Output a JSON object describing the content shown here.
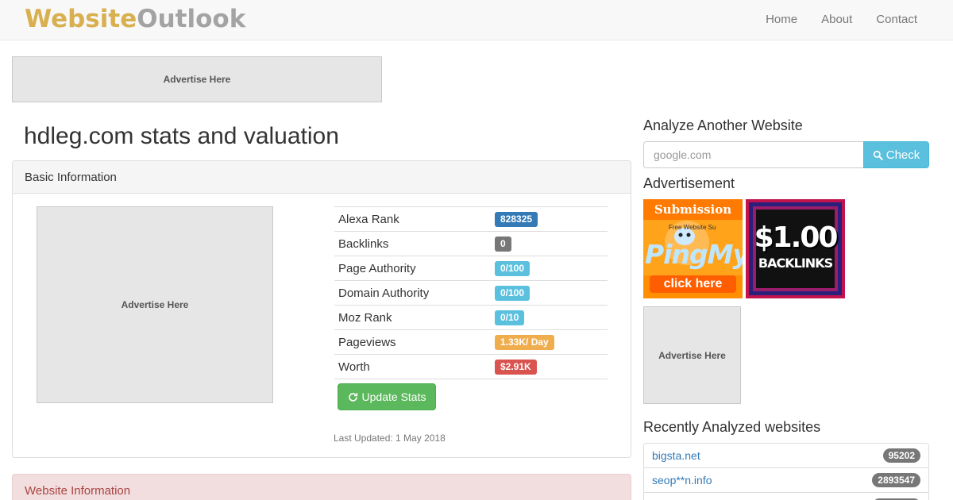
{
  "brand": {
    "part1": "Website",
    "part2": "Outlook"
  },
  "nav": {
    "home": "Home",
    "about": "About",
    "contact": "Contact"
  },
  "ads": {
    "top": "Advertise Here",
    "panel": "Advertise Here",
    "side": "Advertise Here"
  },
  "page_title": "hdleg.com stats and valuation",
  "basic_info": {
    "heading": "Basic Information",
    "rows": [
      {
        "label": "Alexa Rank",
        "value": "828325",
        "color": "#337ab7"
      },
      {
        "label": "Backlinks",
        "value": "0",
        "color": "#777777"
      },
      {
        "label": "Page Authority",
        "value": "0/100",
        "color": "#5bc0de"
      },
      {
        "label": "Domain Authority",
        "value": "0/100",
        "color": "#5bc0de"
      },
      {
        "label": "Moz Rank",
        "value": "0/10",
        "color": "#5bc0de"
      },
      {
        "label": "Pageviews",
        "value": "1.33K/ Day",
        "color": "#f0ad4e"
      },
      {
        "label": "Worth",
        "value": "$2.91K",
        "color": "#d9534f"
      }
    ],
    "update_button": "Update Stats",
    "last_updated": "Last Updated: 1 May 2018"
  },
  "website_info": {
    "heading": "Website Information"
  },
  "sidebar": {
    "analyze_heading": "Analyze Another Website",
    "search_placeholder": "google.com",
    "check_button": "Check",
    "advert_heading": "Advertisement",
    "banner1": {
      "top": "Submission",
      "mid": "Free Website Su",
      "logo": "PingMyL",
      "cta": "click here"
    },
    "banner2": {
      "big": "$1.00",
      "small": "BACKLINKS"
    },
    "recent_heading": "Recently Analyzed websites",
    "recent": [
      {
        "site": "bigsta.net",
        "rank": "95202"
      },
      {
        "site": "seop**n.info",
        "rank": "2893547"
      },
      {
        "site": "",
        "rank": ""
      }
    ]
  }
}
